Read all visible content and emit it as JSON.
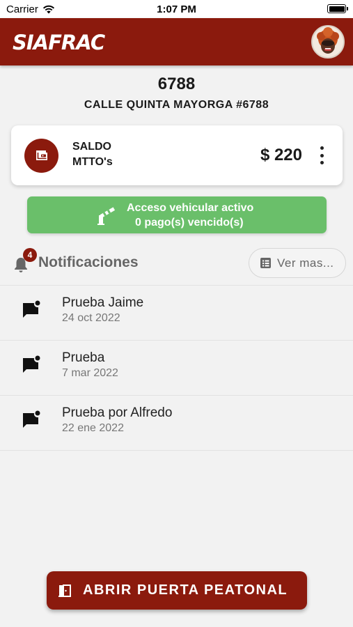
{
  "status_bar": {
    "carrier": "Carrier",
    "time": "1:07 PM"
  },
  "app_bar": {
    "logo": "SIAFRAC"
  },
  "unit": {
    "number": "6788",
    "address": "CALLE QUINTA MAYORGA #6788"
  },
  "balance": {
    "label_line1": "SALDO",
    "label_line2": "MTTO's",
    "amount": "$ 220"
  },
  "access": {
    "line1": "Acceso vehicular activo",
    "line2": "0 pago(s) vencido(s)"
  },
  "notifications": {
    "title": "Notificaciones",
    "badge": "4",
    "see_more": "Ver mas...",
    "items": [
      {
        "title": "Prueba Jaime",
        "date": "24 oct 2022"
      },
      {
        "title": "Prueba",
        "date": "7 mar 2022"
      },
      {
        "title": "Prueba por Alfredo",
        "date": "22 ene 2022"
      }
    ]
  },
  "door_button": {
    "label": "ABRIR PUERTA PEATONAL"
  },
  "colors": {
    "primary": "#8b1a0d",
    "success": "#6abf6a",
    "background": "#f2f2f2"
  }
}
